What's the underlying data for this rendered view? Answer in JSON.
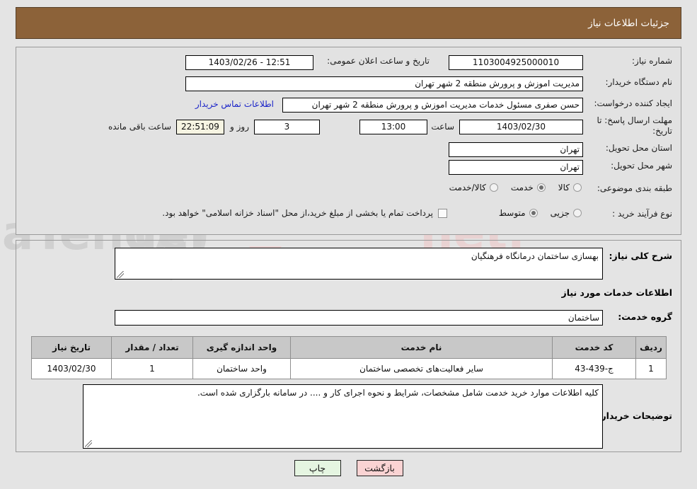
{
  "header": {
    "title": "جزئیات اطلاعات نیاز"
  },
  "watermark": {
    "text": "AriaTender.net"
  },
  "top_panel": {
    "need_number": {
      "label": "شماره نیاز:",
      "value": "1103004925000010"
    },
    "announce_datetime": {
      "label": "تاریخ و ساعت اعلان عمومی:",
      "value": "12:51 - 1403/02/26"
    },
    "buyer_org": {
      "label": "نام دستگاه خریدار:",
      "value": "مدیریت اموزش و پرورش منطقه 2 شهر تهران"
    },
    "request_creator": {
      "label": "ایجاد کننده درخواست:",
      "value": "حسن صفری مسئول خدمات مدیریت اموزش و پرورش منطقه 2 شهر تهران"
    },
    "contact_link": "اطلاعات تماس خریدار",
    "deadline": {
      "label": "مهلت ارسال پاسخ: تا تاریخ:",
      "date": "1403/02/30",
      "hour_label": "ساعت",
      "hour": "13:00",
      "days": "3",
      "days_label": "روز و",
      "countdown": "22:51:09",
      "countdown_label": "ساعت باقی مانده"
    },
    "delivery_province": {
      "label": "استان محل تحویل:",
      "value": "تهران"
    },
    "delivery_city": {
      "label": "شهر محل تحویل:",
      "value": "تهران"
    },
    "category": {
      "label": "طبقه بندی موضوعی:",
      "options": [
        "کالا",
        "خدمت",
        "کالا/خدمت"
      ],
      "selected": "خدمت"
    },
    "purchase_process": {
      "label": "نوع فرآیند خرید :",
      "options": [
        "جزیی",
        "متوسط"
      ],
      "selected": "جزیی"
    },
    "treasury_note": {
      "checked": false,
      "text": "پرداخت تمام یا بخشی از مبلغ خرید،از محل \"اسناد خزانه اسلامی\" خواهد بود."
    }
  },
  "mid_panel": {
    "general_desc": {
      "label": "شرح کلی نیاز:",
      "value": "بهسازی ساختمان درمانگاه فرهنگیان"
    },
    "section_title": "اطلاعات خدمات مورد نیاز",
    "service_group": {
      "label": "گروه خدمت:",
      "value": "ساختمان"
    },
    "table": {
      "columns": [
        "ردیف",
        "کد خدمت",
        "نام خدمت",
        "واحد اندازه گیری",
        "تعداد / مقدار",
        "تاریخ نیاز"
      ],
      "rows": [
        {
          "row_no": "1",
          "service_code": "ج-439-43",
          "service_name": "سایر فعالیت‌های تخصصی ساختمان",
          "unit": "واحد ساختمان",
          "quantity": "1",
          "need_date": "1403/02/30"
        }
      ]
    },
    "buyer_notes": {
      "label": "توضیحات خریدار:",
      "value": "کلیه اطلاعات موارد خرید خدمت  شامل مشخصات، شرایط و نحوه اجرای کار و .... در سامانه بارگزاری شده است."
    }
  },
  "footer": {
    "back_button": "بازگشت",
    "print_button": "چاپ"
  },
  "colors": {
    "header_bg": "#8c6239",
    "page_bg": "#e4e4e4",
    "panel_bg": "#e2e2e2",
    "link": "#1a23c8",
    "countdown_bg": "#f6f4e2",
    "back_btn_bg": "#fad3d3",
    "print_btn_bg": "#e5f5e1",
    "table_head_bg": "#c8c8c8"
  }
}
